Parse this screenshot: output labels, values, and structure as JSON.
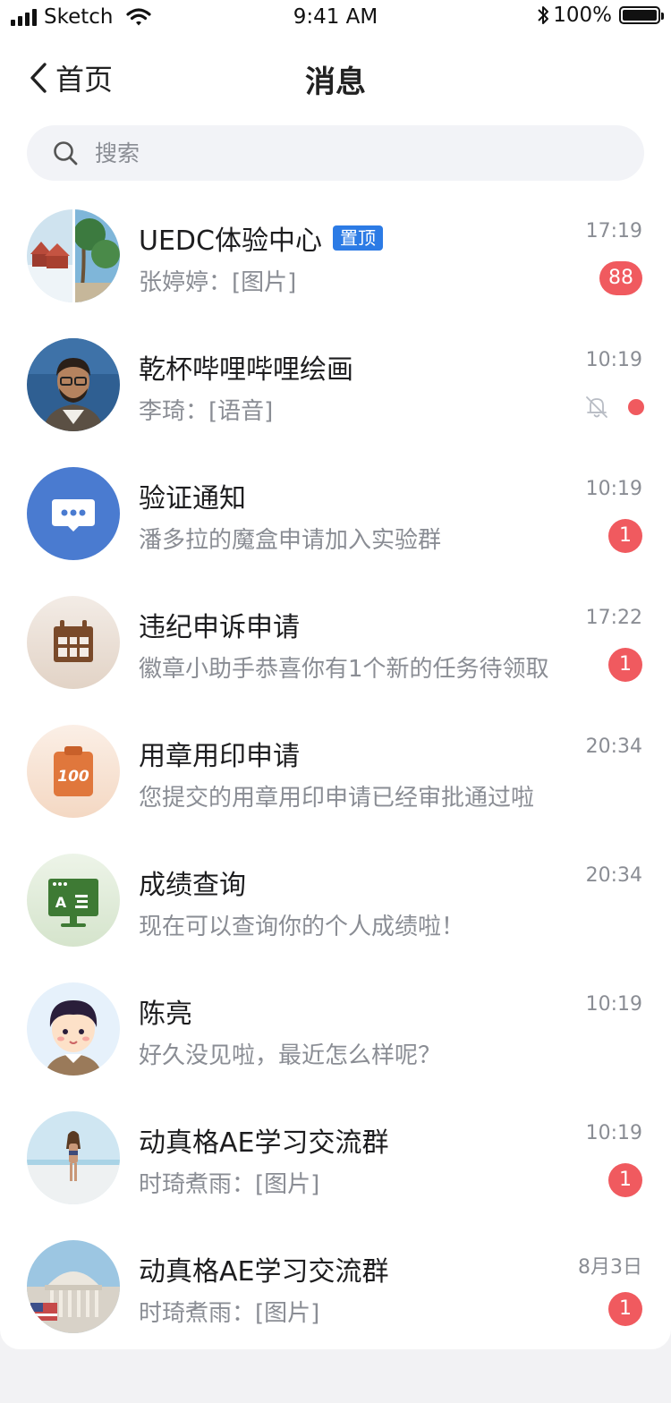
{
  "status_bar": {
    "carrier": "Sketch",
    "time": "9:41 AM",
    "battery": "100%"
  },
  "nav": {
    "back_label": "首页",
    "title": "消息"
  },
  "search": {
    "placeholder": "搜索"
  },
  "colors": {
    "accent": "#2c7be5",
    "unread": "#f05a5f",
    "muted_text": "#8a8d94"
  },
  "conversations": [
    {
      "title": "UEDC体验中心",
      "tag": "置顶",
      "preview": "张婷婷：[图片]",
      "time": "17:19",
      "unread": "88",
      "avatar": "landscape-collage"
    },
    {
      "title": "乾杯哔哩哔哩绘画",
      "preview": "李琦：[语音]",
      "time": "10:19",
      "muted": true,
      "avatar": "man-photo"
    },
    {
      "title": "验证通知",
      "preview": "潘多拉的魔盒申请加入实验群",
      "time": "10:19",
      "unread": "1",
      "avatar": "chat-bubble-icon"
    },
    {
      "title": "违纪申诉申请",
      "preview": "徽章小助手恭喜你有1个新的任务待领取",
      "time": "17:22",
      "unread": "1",
      "avatar": "calendar-icon"
    },
    {
      "title": "用章用印申请",
      "preview": "您提交的用章用印申请已经审批通过啦",
      "time": "20:34",
      "avatar": "clipboard-100-icon"
    },
    {
      "title": "成绩查询",
      "preview": "现在可以查询你的个人成绩啦！",
      "time": "20:34",
      "avatar": "blackboard-icon"
    },
    {
      "title": "陈亮",
      "preview": "好久没见啦，最近怎么样呢？",
      "time": "10:19",
      "avatar": "cartoon-boy"
    },
    {
      "title": "动真格AE学习交流群",
      "preview": "时琦煮雨：[图片]",
      "time": "10:19",
      "unread": "1",
      "avatar": "beach-photo"
    },
    {
      "title": "动真格AE学习交流群",
      "preview": "时琦煮雨：[图片]",
      "time": "8月3日",
      "unread": "1",
      "avatar": "capitol-photo"
    }
  ]
}
